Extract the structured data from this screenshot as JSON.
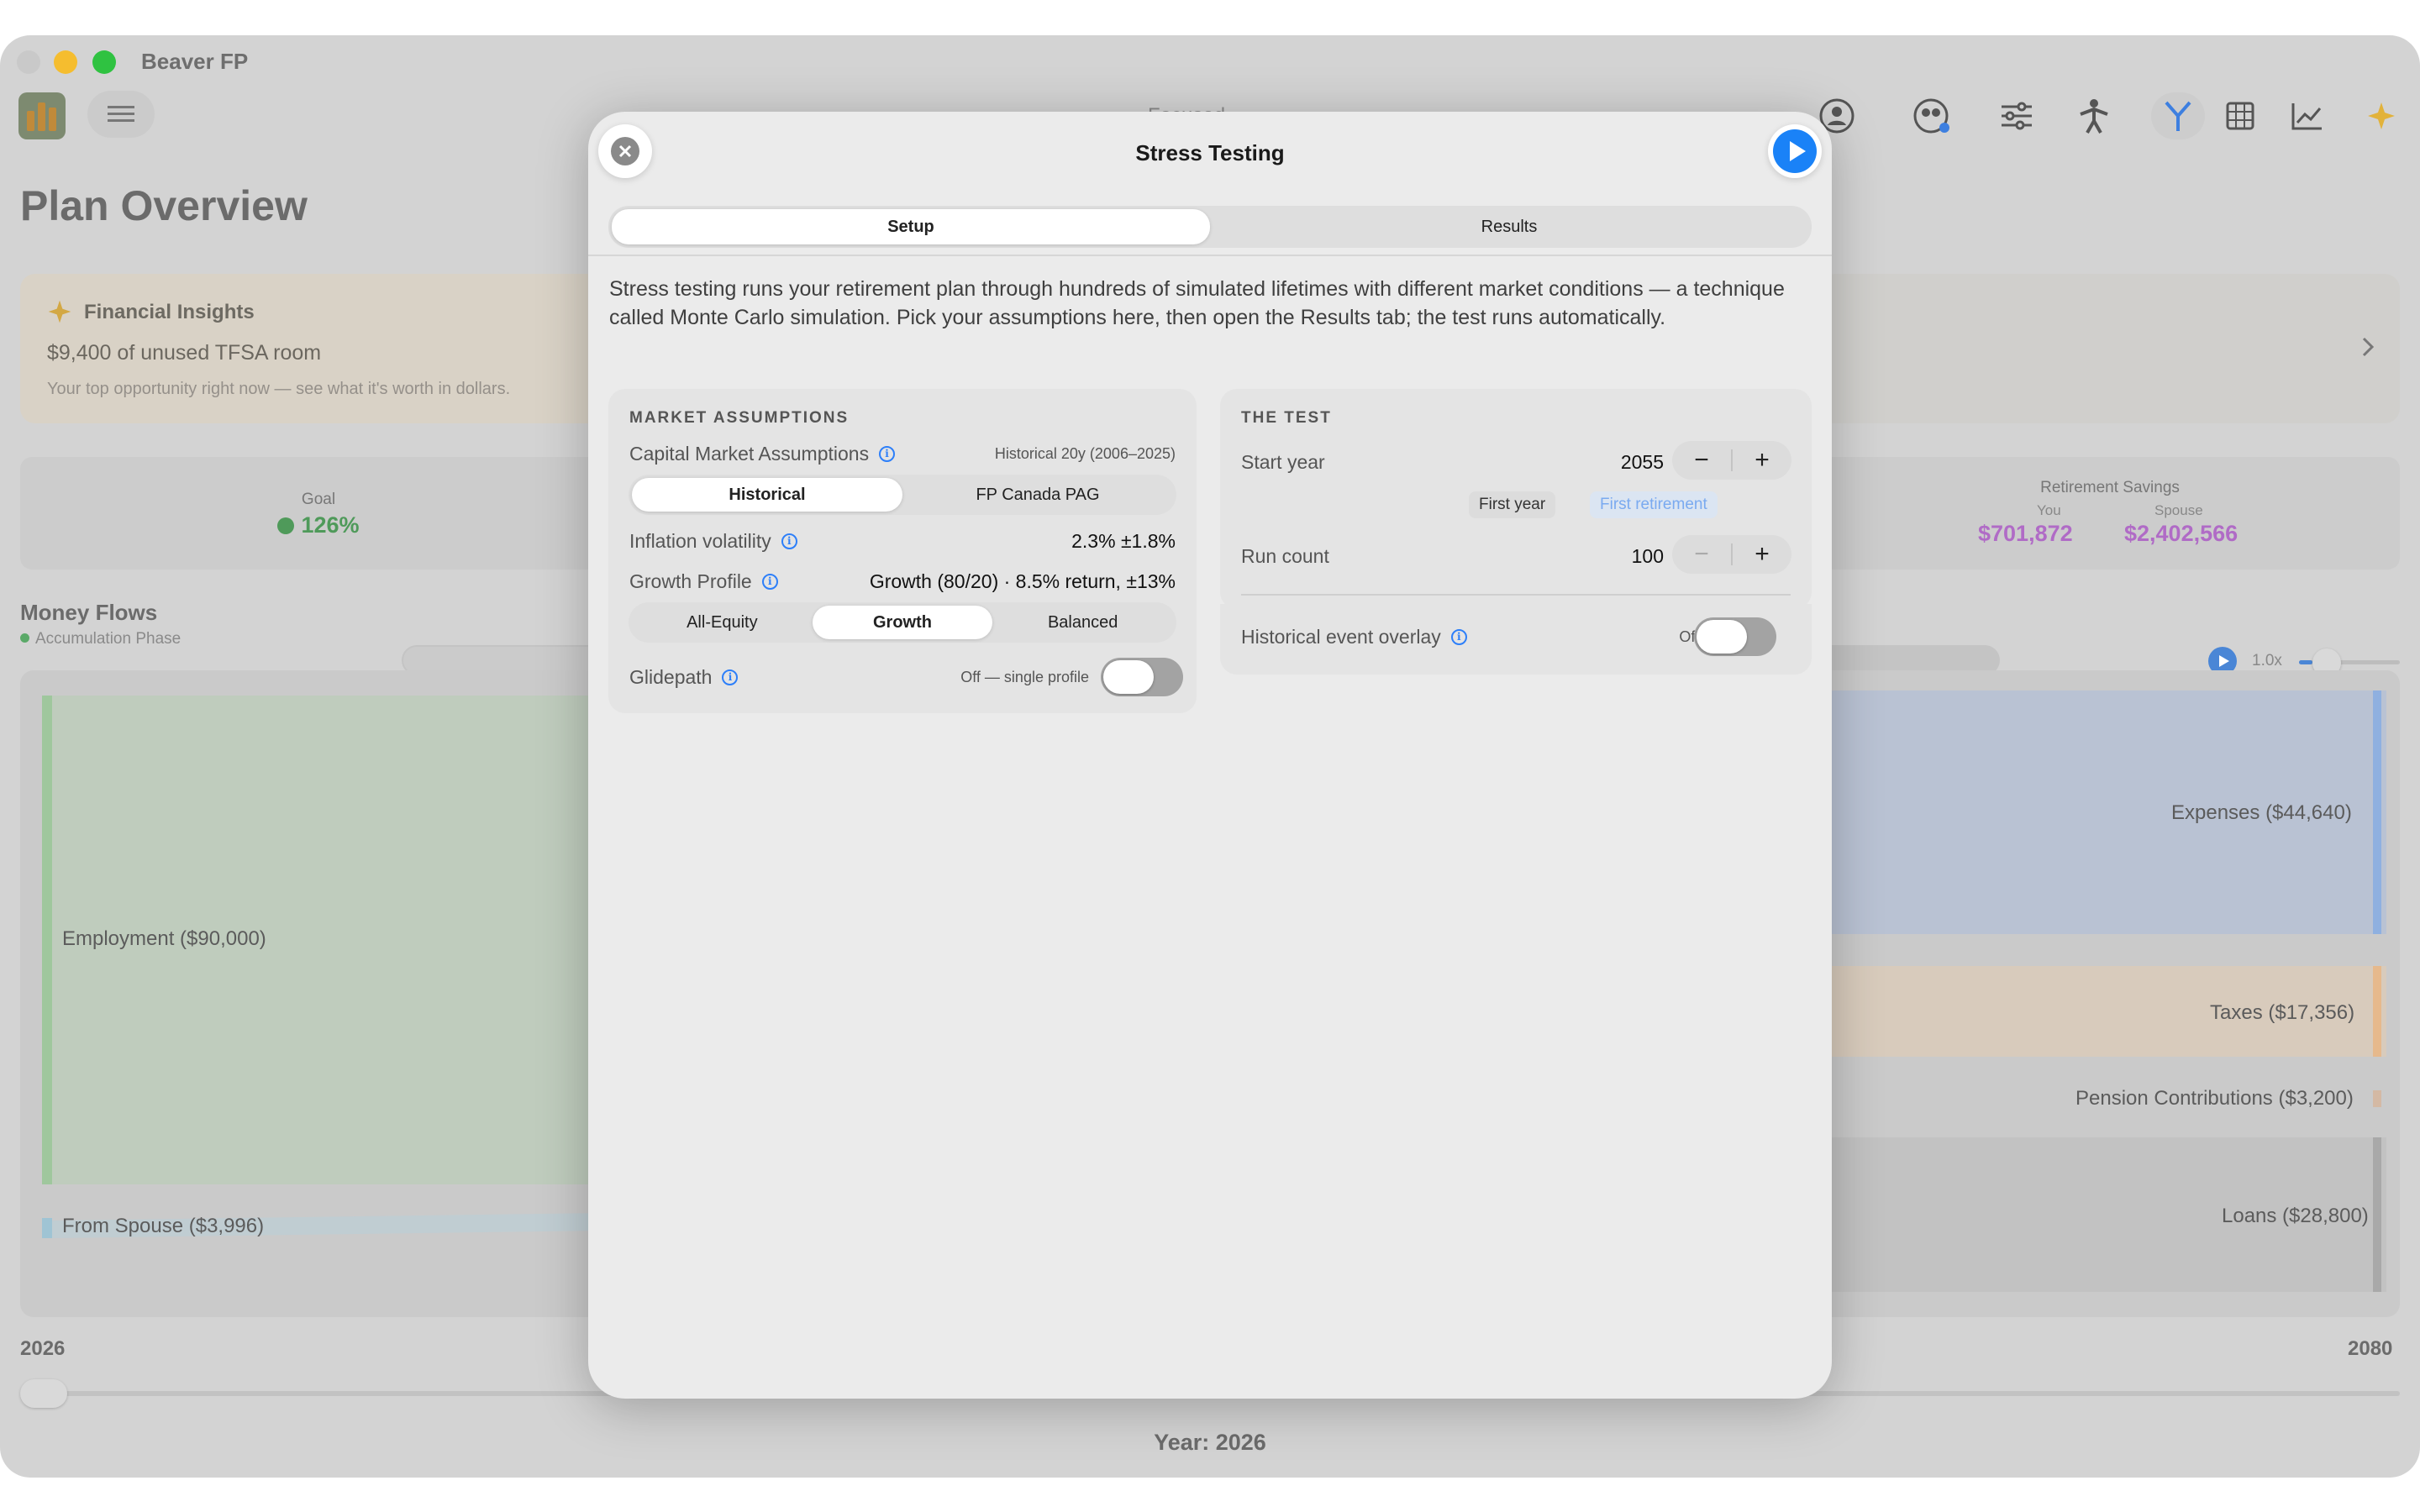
{
  "app": {
    "name": "Beaver FP",
    "toolbar_center": "Focused"
  },
  "toolbar_icons": [
    "person-circle-icon",
    "people-icon",
    "sliders-icon",
    "figure-icon",
    "branch-icon",
    "grid-icon",
    "line-chart-icon",
    "sparkle-icon"
  ],
  "background": {
    "page_title": "Plan Overview",
    "insights": {
      "title": "Financial Insights",
      "line1": "$9,400 of unused TFSA room",
      "line2": "Your top opportunity right now — see what it's worth in dollars."
    },
    "goal": {
      "label": "Goal",
      "value": "126%"
    },
    "retirement_savings": {
      "label": "Retirement Savings",
      "you_label": "You",
      "spouse_label": "Spouse",
      "you_value": "$701,872",
      "spouse_value": "$2,402,566"
    },
    "money_flows": {
      "title": "Money Flows",
      "phase": "Accumulation Phase",
      "speed": "1.0x"
    },
    "flow_labels": {
      "employment": "Employment ($90,000)",
      "from_spouse": "From Spouse ($3,996)",
      "expenses": "Expenses ($44,640)",
      "taxes": "Taxes ($17,356)",
      "pension": "Pension Contributions ($3,200)",
      "loans": "Loans ($28,800)"
    },
    "timeline": {
      "start": "2026",
      "end": "2080",
      "current": "Year: 2026"
    }
  },
  "modal": {
    "title": "Stress Testing",
    "tabs": [
      {
        "label": "Setup",
        "selected": true
      },
      {
        "label": "Results",
        "selected": false
      }
    ],
    "description": "Stress testing runs your retirement plan through hundreds of simulated lifetimes with different market conditions — a technique called Monte Carlo simulation. Pick your assumptions here, then open the Results tab; the test runs automatically.",
    "market": {
      "section": "MARKET ASSUMPTIONS",
      "cma_label": "Capital Market Assumptions",
      "cma_value": "Historical 20y (2006–2025)",
      "cma_options": [
        {
          "label": "Historical",
          "selected": true
        },
        {
          "label": "FP Canada PAG",
          "selected": false
        }
      ],
      "inflation_label": "Inflation volatility",
      "inflation_value": "2.3% ±1.8%",
      "growth_label": "Growth Profile",
      "growth_value": "Growth (80/20) · 8.5% return, ±13%",
      "growth_options": [
        {
          "label": "All-Equity",
          "selected": false
        },
        {
          "label": "Growth",
          "selected": true
        },
        {
          "label": "Balanced",
          "selected": false
        }
      ],
      "glidepath_label": "Glidepath",
      "glidepath_value": "Off — single profile"
    },
    "test": {
      "section": "THE TEST",
      "start_year_label": "Start year",
      "start_year_value": "2055",
      "chips": [
        "First year",
        "First retirement"
      ],
      "run_count_label": "Run count",
      "run_count_value": "100",
      "overlay_label": "Historical event overlay",
      "overlay_value": "Off"
    }
  },
  "colors": {
    "accent": "#1a82f7",
    "goal_green": "#4f9a5a",
    "savings_purple": "#b06bc6"
  }
}
